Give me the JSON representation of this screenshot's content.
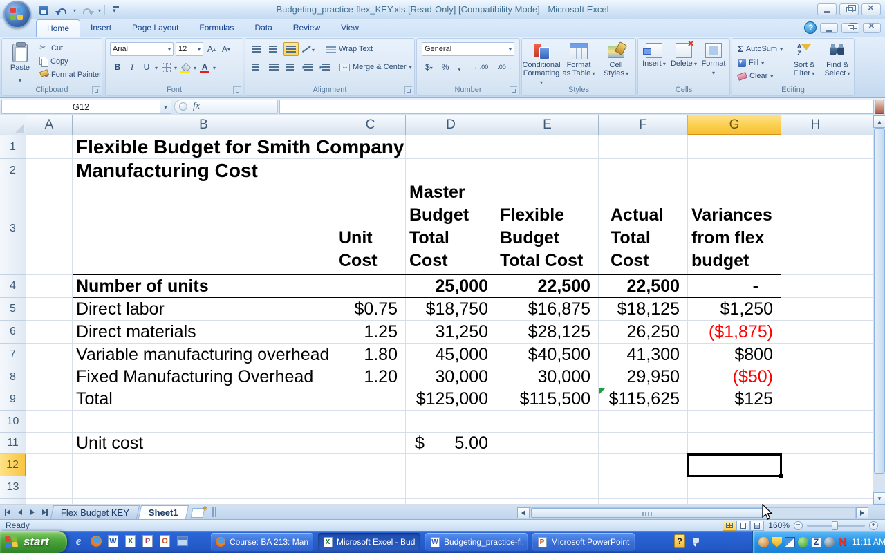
{
  "title_bar": {
    "title": "Budgeting_practice-flex_KEY.xls  [Read-Only]  [Compatibility Mode] - Microsoft Excel"
  },
  "ribbon": {
    "tabs": [
      "Home",
      "Insert",
      "Page Layout",
      "Formulas",
      "Data",
      "Review",
      "View"
    ],
    "active_tab": "Home",
    "groups": {
      "clipboard": {
        "label": "Clipboard",
        "paste": "Paste",
        "cut": "Cut",
        "copy": "Copy",
        "format_painter": "Format Painter"
      },
      "font": {
        "label": "Font",
        "family": "Arial",
        "size": "12",
        "bold": "B",
        "italic": "I",
        "underline": "U",
        "grow": "A",
        "shrink": "A",
        "color_a": "A"
      },
      "alignment": {
        "label": "Alignment",
        "wrap_text": "Wrap Text",
        "merge_center": "Merge & Center"
      },
      "number": {
        "label": "Number",
        "format": "General",
        "currency": "$",
        "percent": "%",
        "comma": ","
      },
      "styles": {
        "label": "Styles",
        "conditional": "Conditional\nFormatting",
        "format_table": "Format\nas Table",
        "cell_styles": "Cell\nStyles"
      },
      "cells": {
        "label": "Cells",
        "insert": "Insert",
        "delete": "Delete",
        "format": "Format"
      },
      "editing": {
        "label": "Editing",
        "sigma": "Σ",
        "autosum": "AutoSum",
        "fill": "Fill",
        "clear": "Clear",
        "sort_filter": "Sort &\nFilter",
        "find_select": "Find &\nSelect"
      }
    }
  },
  "formula_bar": {
    "name_box": "G12",
    "fx": "fx",
    "formula": ""
  },
  "grid": {
    "selected_cell": "G12",
    "selected_column": "G",
    "selected_row": "12",
    "columns": [
      "A",
      "B",
      "C",
      "D",
      "E",
      "F",
      "G",
      "H"
    ],
    "row_numbers": [
      "1",
      "2",
      "3",
      "4",
      "5",
      "6",
      "7",
      "8",
      "9",
      "10",
      "11",
      "12",
      "13"
    ],
    "cells": {
      "B1": "Flexible Budget for Smith Company",
      "B2": "Manufacturing Cost",
      "C3": "Unit\nCost",
      "D3": "Master\nBudget\nTotal\nCost",
      "E3": "Flexible\nBudget\nTotal Cost",
      "F3": "Actual\nTotal\nCost",
      "G3": "Variances\nfrom flex\nbudget",
      "B4": "Number of units",
      "D4": "25,000",
      "E4": "22,500",
      "F4": "22,500",
      "G4": "-",
      "B5": "Direct labor",
      "C5": "$0.75",
      "D5": "$18,750",
      "E5": "$16,875",
      "F5": "$18,125",
      "G5": "$1,250",
      "B6": "Direct materials",
      "C6": "1.25",
      "D6": "31,250",
      "E6": "$28,125",
      "F6": "26,250",
      "G6": "($1,875)",
      "B7": "Variable manufacturing overhead",
      "C7": "1.80",
      "D7": "45,000",
      "E7": "$40,500",
      "F7": "41,300",
      "G7": "$800",
      "B8": "Fixed Manufacturing Overhead",
      "C8": "1.20",
      "D8": "30,000",
      "E8": "30,000",
      "F8": "29,950",
      "G8": "($50)",
      "B9": "Total",
      "D9": "$125,000",
      "E9": "$115,500",
      "F9": "$115,625",
      "G9": "$125",
      "B11": "Unit cost",
      "D11_currency": "$",
      "D11_value": "5.00"
    },
    "negative_color": "#ff0000"
  },
  "sheet_tabs": {
    "tabs": [
      "Flex Budget KEY",
      "Sheet1"
    ],
    "active": "Sheet1"
  },
  "status_bar": {
    "mode": "Ready",
    "zoom_level": "160%"
  },
  "taskbar": {
    "start_label": "start",
    "quick_launch_icons": [
      "internet-explorer-icon",
      "firefox-icon",
      "word-icon",
      "excel-icon",
      "publisher-icon",
      "powerpoint-icon",
      "window-icon"
    ],
    "tasks": [
      {
        "icon": "firefox-icon",
        "label": "Course: BA 213: Man..."
      },
      {
        "icon": "excel-icon",
        "label": "Microsoft Excel - Bud..."
      },
      {
        "icon": "word-icon",
        "label": "Budgeting_practice-fl..."
      },
      {
        "icon": "powerpoint-icon",
        "label": "Microsoft PowerPoint ..."
      }
    ],
    "tray_icons": [
      "messenger-icon",
      "shield-icon",
      "security-icon",
      "update-icon",
      "zonealarm-icon",
      "status-icon",
      "antivirus-icon"
    ],
    "clock": "11:11 AM"
  },
  "colors": {
    "selection_highlight": "#f9c440",
    "negative_number": "#ff0000",
    "taskbar_blue": "#2a66d8",
    "start_green": "#4aa43a",
    "tray_blue": "#2693e6"
  }
}
